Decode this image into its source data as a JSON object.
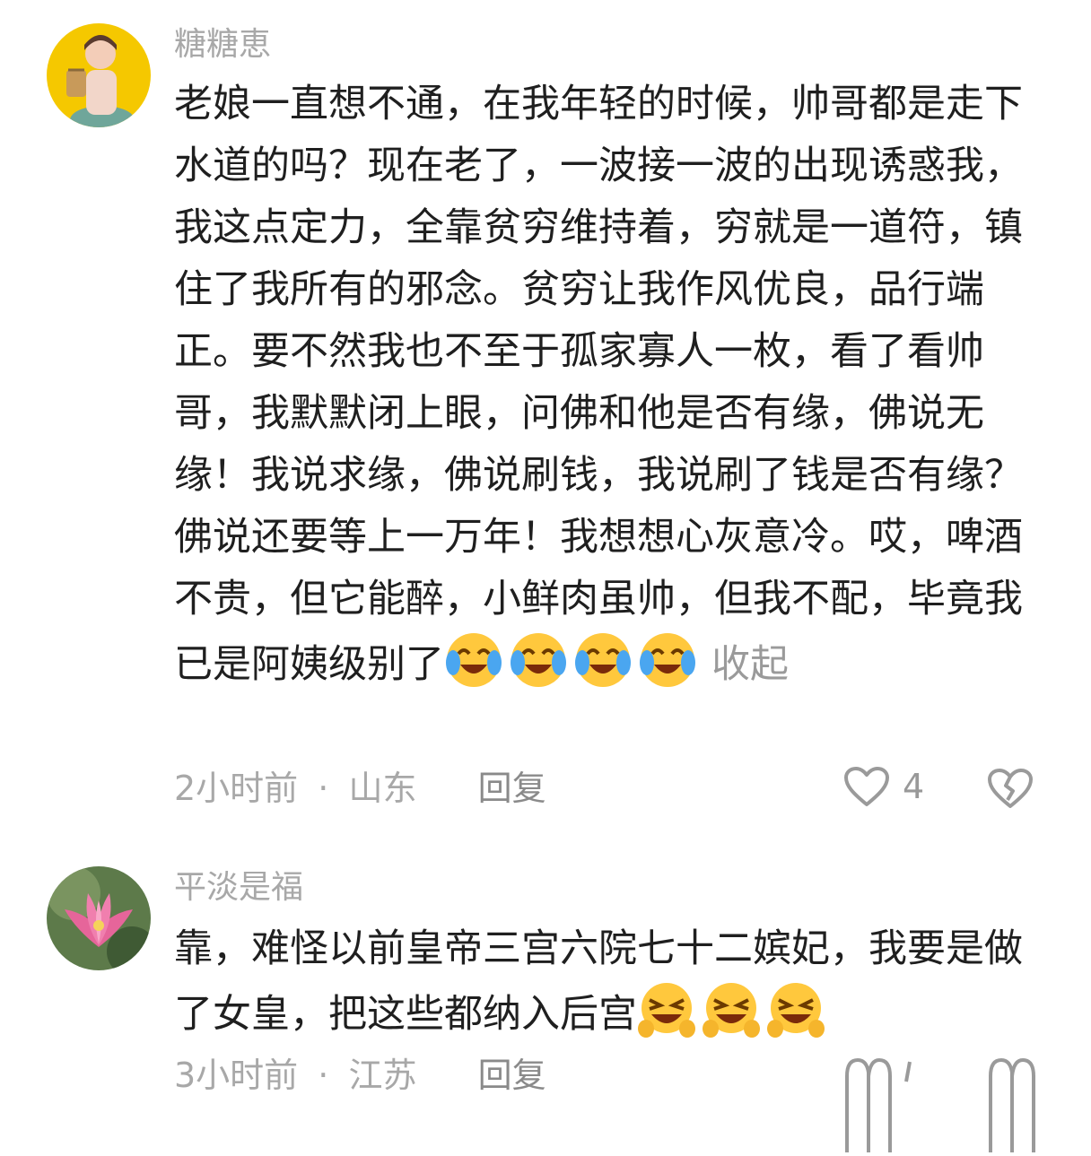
{
  "comments": [
    {
      "username": "糖糖恵",
      "text": "老娘一直想不通，在我年轻的时候，帅哥都是走下水道的吗？现在老了，一波接一波的出现诱惑我， 我这点定力，全靠贫穷维持着，穷就是一道符，镇住了我所有的邪念。贫穷让我作风优良，品行端正。要不然我也不至于孤家寡人一枚，看了看帅哥，我默默闭上眼，问佛和他是否有缘，佛说无缘！我说求缘，佛说刷钱，我说刷了钱是否有缘？佛说还要等上一万年！我想想心灰意冷。哎，啤酒不贵，但它能醉，小鲜肉虽帅，但我不配，毕竟我已是阿姨级别了",
      "emoji": "crying-laughing",
      "emoji_count": 4,
      "collapse_label": "收起",
      "time": "2小时前",
      "separator": "·",
      "location": "山东",
      "reply_label": "回复",
      "likes": "4"
    },
    {
      "username": "平淡是福",
      "text": "靠，难怪以前皇帝三宫六院七十二嫔妃，我要是做了女皇，把这些都纳入后宫",
      "emoji": "squinting-laughing",
      "emoji_count": 3,
      "time": "3小时前",
      "separator": "·",
      "location": "江苏",
      "reply_label": "回复"
    }
  ],
  "colors": {
    "username": "#a8a8a8",
    "body_text": "#1f1f1f",
    "meta_text": "#a8a8a8",
    "avatar1_bg": "#f5c800",
    "emoji_face": "#ffc83d"
  },
  "icons": {
    "like": "heart-outline-icon",
    "dislike": "broken-heart-icon"
  }
}
